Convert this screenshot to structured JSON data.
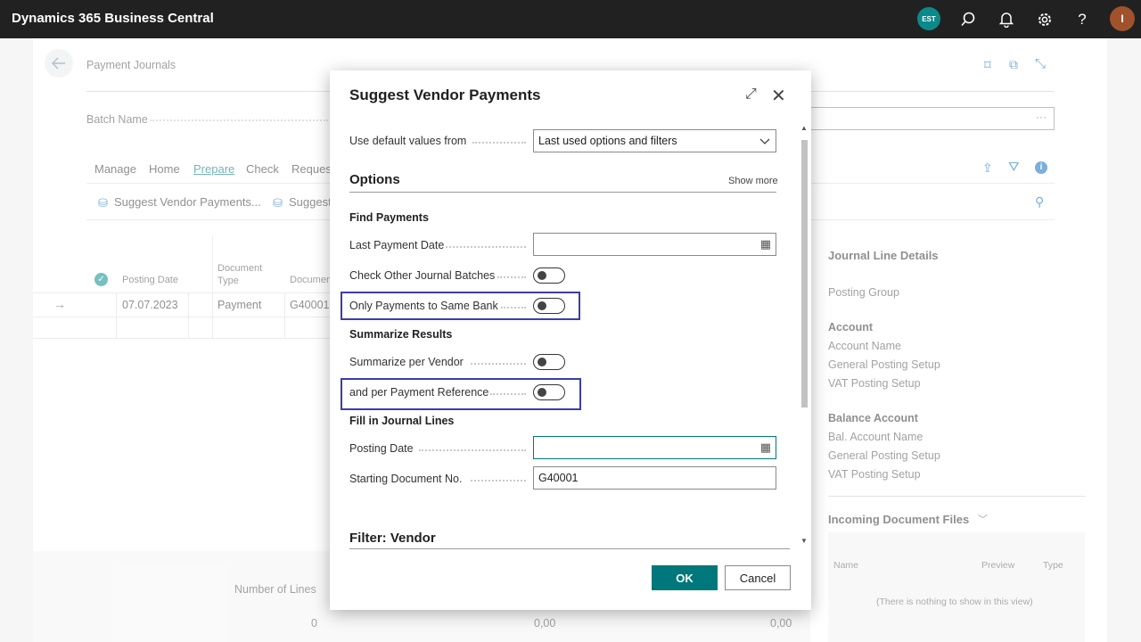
{
  "topbar": {
    "title": "Dynamics 365 Business Central",
    "company_badge": "EST",
    "user_initial": "I",
    "icons": [
      "search-icon",
      "bell-icon",
      "gear-icon",
      "help-icon"
    ]
  },
  "page": {
    "breadcrumb": "Payment Journals",
    "batch_name_label": "Batch Name",
    "menu": [
      "Manage",
      "Home",
      "Prepare",
      "Check",
      "Request"
    ],
    "actions": [
      "Suggest Vendor Payments...",
      "Suggest"
    ],
    "table": {
      "headers": [
        "Posting Date",
        "Document Type",
        "Documen"
      ],
      "header_doc_type_lines": [
        "Document",
        "Type"
      ],
      "row": {
        "posting_date": "07.07.2023",
        "doc_type": "Payment",
        "doc_no": "G40001"
      }
    },
    "footer": {
      "number_of_lines_label": "Number of Lines",
      "number_of_lines": "0",
      "amount1": "0,00",
      "amount2": "0,00"
    },
    "details": {
      "title": "Journal Line Details",
      "posting_group": "Posting Group",
      "account_head": "Account",
      "account_items": [
        "Account Name",
        "General Posting Setup",
        "VAT Posting Setup"
      ],
      "balance_head": "Balance Account",
      "balance_items": [
        "Bal. Account Name",
        "General Posting Setup",
        "VAT Posting Setup"
      ],
      "incoming_title": "Incoming Document Files",
      "incoming_cols": [
        "Name",
        "Preview",
        "Type"
      ],
      "incoming_empty": "(There is nothing to show in this view)"
    }
  },
  "dialog": {
    "title": "Suggest Vendor Payments",
    "use_default_label": "Use default values from",
    "use_default_value": "Last used options and filters",
    "options_title": "Options",
    "show_more": "Show more",
    "find_payments": "Find Payments",
    "last_payment_date_label": "Last Payment Date",
    "last_payment_date_value": "",
    "check_other_label": "Check Other Journal Batches",
    "only_same_bank_label": "Only Payments to Same Bank",
    "summarize_results": "Summarize Results",
    "summarize_vendor_label": "Summarize per Vendor",
    "per_payment_ref_label": "and per Payment Reference",
    "fill_in_lines": "Fill in Journal Lines",
    "posting_date_label": "Posting Date",
    "posting_date_value": "",
    "starting_doc_label": "Starting Document No.",
    "starting_doc_value": "G40001",
    "filter_vendor": "Filter: Vendor",
    "ok": "OK",
    "cancel": "Cancel"
  }
}
